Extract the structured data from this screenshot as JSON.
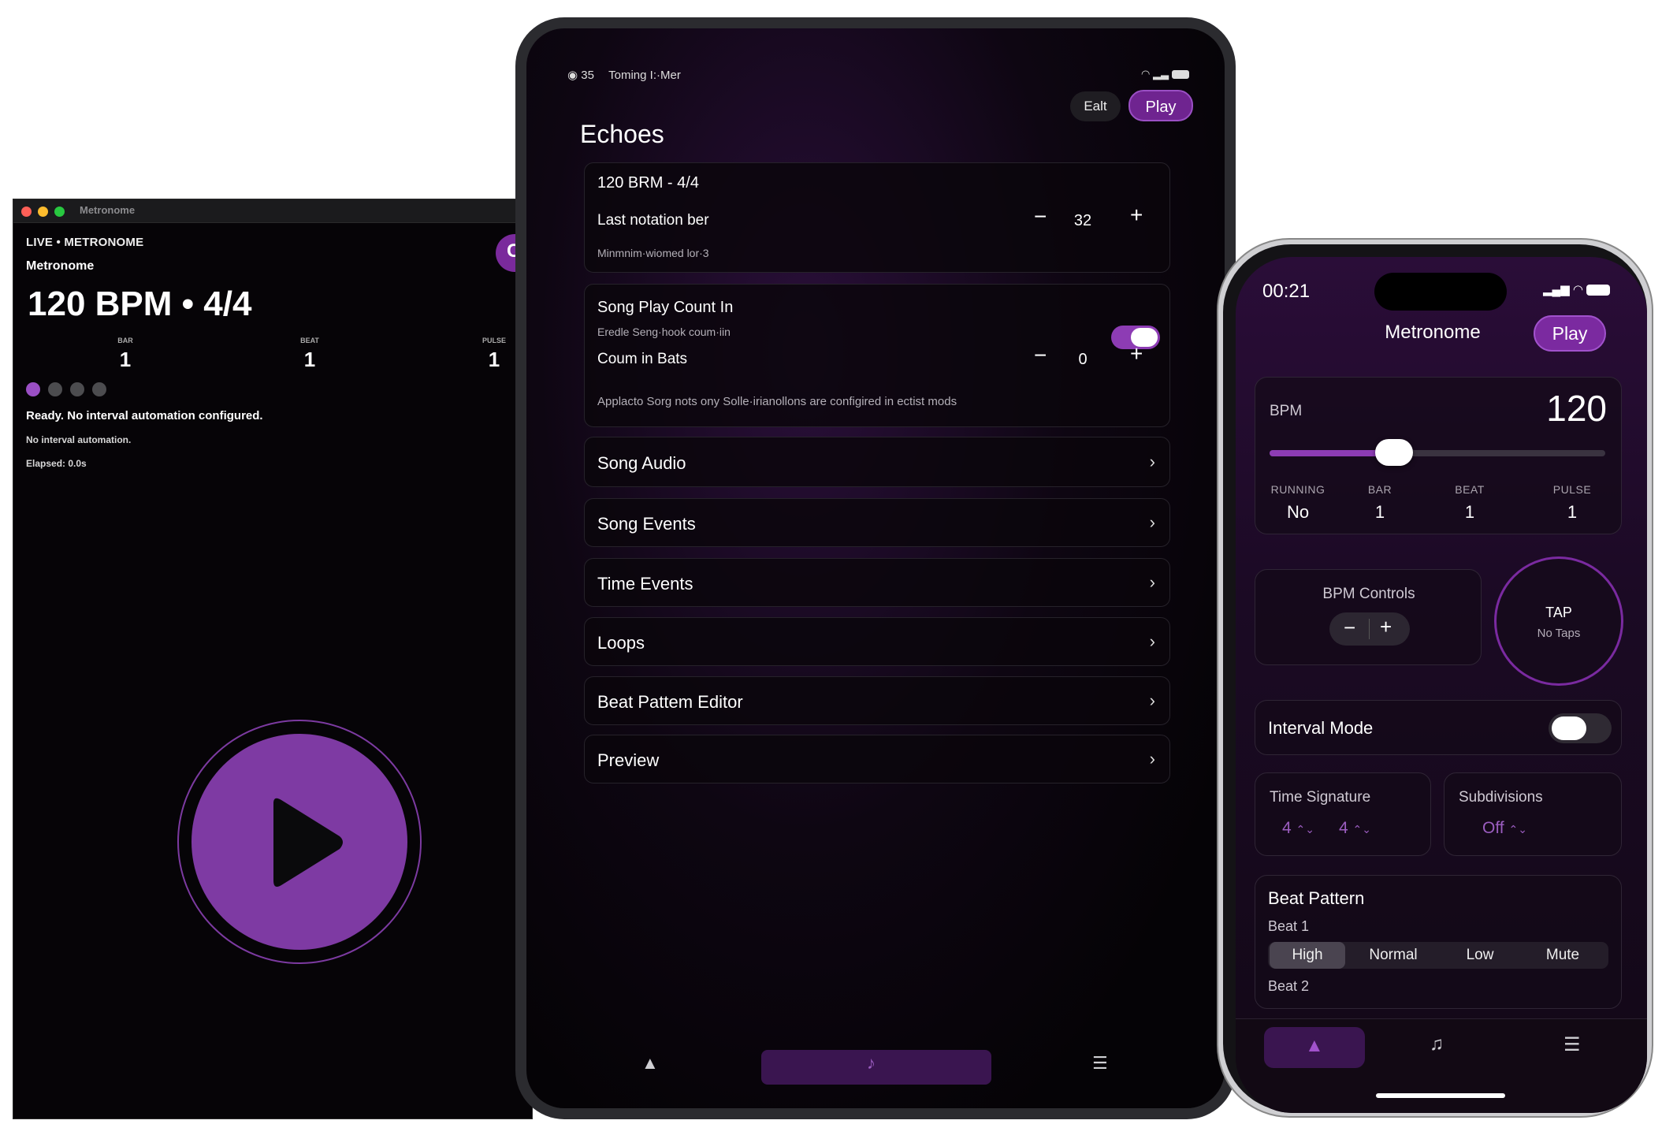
{
  "mac": {
    "window_title": "Metronome",
    "live_label": "LIVE • METRONOME",
    "subtitle": "Metronome",
    "headline": "120 BPM • 4/4",
    "edge_button_label": "C",
    "counters": [
      {
        "label": "BAR",
        "value": "1"
      },
      {
        "label": "BEAT",
        "value": "1"
      },
      {
        "label": "PULSE",
        "value": "1"
      }
    ],
    "status": "Ready. No interval automation configured.",
    "interval_text": "No interval automation.",
    "elapsed": "Elapsed: 0.0s",
    "colors": {
      "accent": "#7e3aa3",
      "close": "#fe5f57",
      "minimize": "#febc2e",
      "zoom": "#28c840"
    }
  },
  "tablet": {
    "status_left": "35",
    "status_text": "Toming I:·Mer",
    "edit_label": "Ealt",
    "play_label": "Play",
    "title": "Echoes",
    "tempo_card": {
      "header": "120 BRM  -  4/4",
      "row_label": "Last notation ber",
      "value": "32",
      "hint": "Minmnim·wiomed lor·3"
    },
    "count_in_card": {
      "title": "Song Play Count In",
      "hint": "Eredle Seng·hook coum·iin",
      "row_label": "Coum in Bats",
      "value": "0",
      "footnote": "Applacto Sorg nots ony Solle·irianollons are configired in ectist mods"
    },
    "nav_items": [
      "Song Audio",
      "Song Events",
      "Time Events",
      "Loops",
      "Beat Pattem Editor",
      "Preview"
    ],
    "minus": "−",
    "plus": "+",
    "chevron": "›"
  },
  "phone": {
    "time": "00:21",
    "title": "Metronome",
    "play_label": "Play",
    "bpm_label": "BPM",
    "bpm_value": "120",
    "slider_fraction": 0.37,
    "stats": [
      {
        "label": "RUNNING",
        "value": "No"
      },
      {
        "label": "BAR",
        "value": "1"
      },
      {
        "label": "BEAT",
        "value": "1"
      },
      {
        "label": "PULSE",
        "value": "1"
      }
    ],
    "bpm_controls_label": "BPM Controls",
    "minus": "−",
    "plus": "+",
    "tap_label": "TAP",
    "tap_sub": "No Taps",
    "interval_mode_label": "Interval Mode",
    "time_signature_label": "Time Signature",
    "ts_top": "4",
    "ts_bottom": "4",
    "subdivisions_label": "Subdivisions",
    "subdivisions_value": "Off",
    "updown": "⌃⌄",
    "beat_pattern_title": "Beat Pattern",
    "beat1_label": "Beat 1",
    "beat2_label": "Beat 2",
    "levels": [
      "High",
      "Normal",
      "Low",
      "Mute"
    ]
  }
}
